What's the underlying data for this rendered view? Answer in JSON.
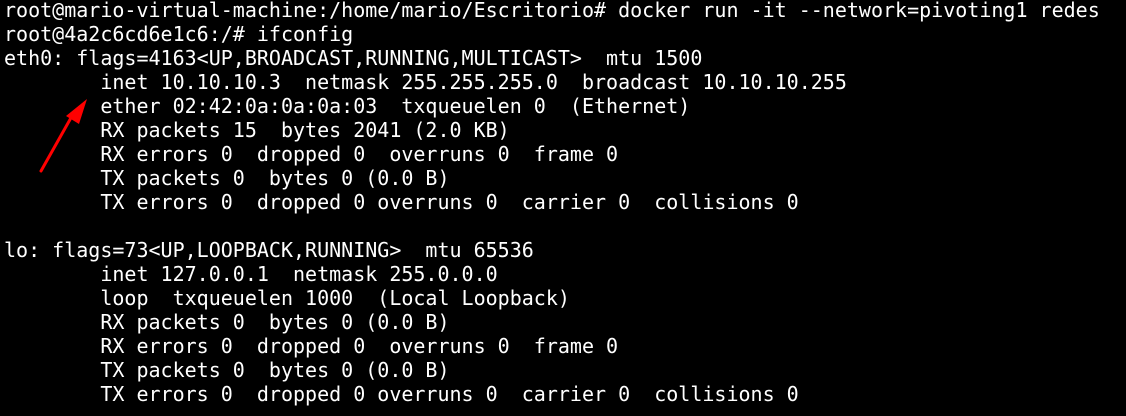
{
  "terminal": {
    "lines": [
      "root@mario-virtual-machine:/home/mario/Escritorio# docker run -it --network=pivoting1 redes",
      "root@4a2c6cd6e1c6:/# ifconfig",
      "eth0: flags=4163<UP,BROADCAST,RUNNING,MULTICAST>  mtu 1500",
      "        inet 10.10.10.3  netmask 255.255.255.0  broadcast 10.10.10.255",
      "        ether 02:42:0a:0a:0a:03  txqueuelen 0  (Ethernet)",
      "        RX packets 15  bytes 2041 (2.0 KB)",
      "        RX errors 0  dropped 0  overruns 0  frame 0",
      "        TX packets 0  bytes 0 (0.0 B)",
      "        TX errors 0  dropped 0 overruns 0  carrier 0  collisions 0",
      "",
      "lo: flags=73<UP,LOOPBACK,RUNNING>  mtu 65536",
      "        inet 127.0.0.1  netmask 255.0.0.0",
      "        loop  txqueuelen 1000  (Local Loopback)",
      "        RX packets 0  bytes 0 (0.0 B)",
      "        RX errors 0  dropped 0  overruns 0  frame 0",
      "        TX packets 0  bytes 0 (0.0 B)",
      "        TX errors 0  dropped 0 overruns 0  carrier 0  collisions 0"
    ]
  },
  "colors": {
    "background": "#000000",
    "text": "#ffffff",
    "arrow": "#ff0000"
  },
  "icons": {
    "annotation_arrow": "red-arrow-icon"
  }
}
